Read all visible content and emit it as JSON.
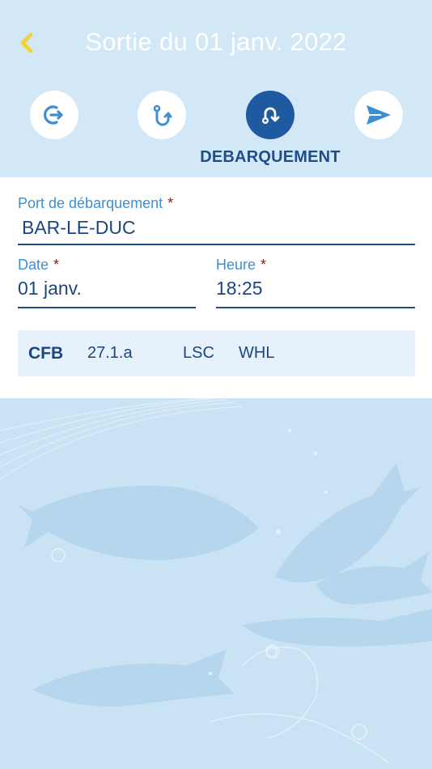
{
  "header": {
    "title": "Sortie du 01 janv. 2022",
    "active_step_label": "DEBARQUEMENT",
    "back_icon": "chevron-left-icon",
    "accent_color": "#f2d43a",
    "steps": [
      {
        "icon": "exit-icon",
        "active": false
      },
      {
        "icon": "fishing-hook-icon",
        "active": false
      },
      {
        "icon": "landing-icon",
        "active": true
      },
      {
        "icon": "send-icon",
        "active": false
      }
    ]
  },
  "form": {
    "port": {
      "label": "Port de débarquement",
      "required_mark": "*",
      "value": "BAR-LE-DUC"
    },
    "date": {
      "label": "Date",
      "required_mark": "*",
      "value": "01 janv."
    },
    "time": {
      "label": "Heure",
      "required_mark": "*",
      "value": "18:25"
    },
    "info": {
      "species": "CFB",
      "zone": "27.1.a",
      "gear": "LSC",
      "code": "WHL"
    }
  },
  "colors": {
    "header_bg": "#d3e8f6",
    "primary": "#1f5aa0",
    "label_blue": "#3d8fd1",
    "required_red": "#8a1c1c",
    "background": "#c9e2f4"
  }
}
